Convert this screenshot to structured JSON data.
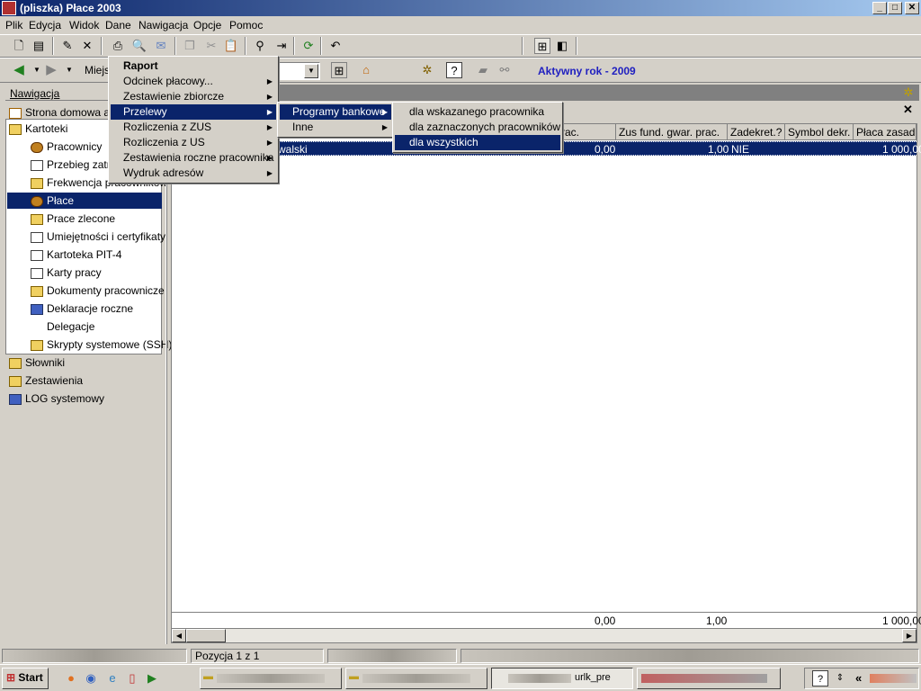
{
  "window": {
    "title": "(pliszka)  Płace 2003",
    "min": "_",
    "max": "□",
    "close": "✕"
  },
  "menubar": [
    "Plik",
    "Edycja",
    "Widok",
    "Dane",
    "Nawigacja",
    "Opcje",
    "Pomoc"
  ],
  "toolbar2": {
    "location_label": "Miejs",
    "active_year": "Aktywny rok - 2009"
  },
  "nav": {
    "header": "Nawigacja",
    "items": {
      "home": "Strona domowa ap",
      "kartoteki": "Kartoteki",
      "pracownicy": "Pracownicy",
      "przebieg": "Przebieg zatru",
      "frekwencja": "Frekwencja pracowników",
      "place": "Płace",
      "place_zlecone": "Prace zlecone",
      "umiejetnosci": "Umiejętności i certyfikaty",
      "pit4": "Kartoteka PIT-4",
      "karty": "Karty pracy",
      "dokumenty": "Dokumenty pracownicze",
      "deklaracje": "Deklaracje roczne",
      "delegacje": "Delegacje",
      "skrypty": "Skrypty systemowe (SSH)",
      "slowniki": "Słowniki",
      "zestawienia": "Zestawienia",
      "log": "LOG systemowy"
    }
  },
  "grid": {
    "columns": [
      "rac.",
      "Zus fund. gwar. prac.",
      "Zadekret.?",
      "Symbol dekr.",
      "Płaca zasad."
    ],
    "row": {
      "name": "walski",
      "a": "0,00",
      "b": "1,00",
      "c": "NIE",
      "d": "1 000,00"
    },
    "totals": {
      "a": "0,00",
      "b": "1,00",
      "d": "1 000,00"
    }
  },
  "menu1": {
    "items": [
      "Raport",
      "Odcinek płacowy...",
      "Zestawienie zbiorcze",
      "Przelewy",
      "Rozliczenia z ZUS",
      "Rozliczenia z US",
      "Zestawienia roczne pracownika",
      "Wydruk adresów"
    ]
  },
  "menu2": {
    "items": [
      "Programy bankowe",
      "Inne"
    ]
  },
  "menu3": {
    "items": [
      "dla wskazanego pracownika",
      "dla zaznaczonych pracowników",
      "dla wszystkich"
    ]
  },
  "status": {
    "pos": "Pozycja 1 z 1"
  },
  "taskbar": {
    "start": "Start",
    "task3": "urlk_pre",
    "lang": "«"
  }
}
